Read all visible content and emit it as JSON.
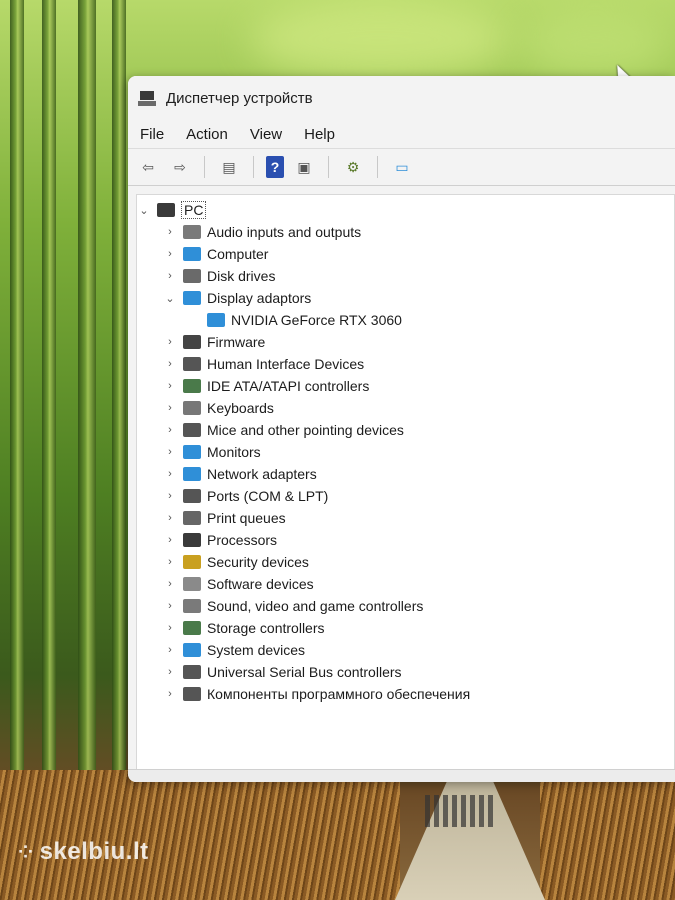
{
  "window": {
    "title": "Диспетчер устройств"
  },
  "menu": [
    "File",
    "Action",
    "View",
    "Help"
  ],
  "toolbar": [
    {
      "name": "back-icon",
      "glyph": "⇦"
    },
    {
      "name": "forward-icon",
      "glyph": "⇨"
    },
    {
      "name": "sep"
    },
    {
      "name": "properties-icon",
      "glyph": "▤"
    },
    {
      "name": "sep"
    },
    {
      "name": "help-icon",
      "glyph": "?"
    },
    {
      "name": "view-icon",
      "glyph": "▣"
    },
    {
      "name": "sep"
    },
    {
      "name": "scan-hardware-icon",
      "glyph": "⚙"
    },
    {
      "name": "sep"
    },
    {
      "name": "monitor-icon",
      "glyph": "▭"
    }
  ],
  "tree": {
    "root": "PC",
    "items": [
      {
        "label": "Audio inputs and outputs",
        "icon": "speaker-icon",
        "color": "#7a7a7a",
        "expanded": false
      },
      {
        "label": "Computer",
        "icon": "computer-icon",
        "color": "#2f8fd8",
        "expanded": false
      },
      {
        "label": "Disk drives",
        "icon": "disk-icon",
        "color": "#6a6a6a",
        "expanded": false
      },
      {
        "label": "Display adaptors",
        "icon": "display-adapter-icon",
        "color": "#2f8fd8",
        "expanded": true,
        "children": [
          {
            "label": "NVIDIA GeForce RTX 3060",
            "icon": "display-adapter-icon",
            "color": "#2f8fd8"
          }
        ]
      },
      {
        "label": "Firmware",
        "icon": "chip-icon",
        "color": "#444444",
        "expanded": false
      },
      {
        "label": "Human Interface Devices",
        "icon": "hid-icon",
        "color": "#555555",
        "expanded": false
      },
      {
        "label": "IDE ATA/ATAPI controllers",
        "icon": "ide-icon",
        "color": "#4a7a4a",
        "expanded": false
      },
      {
        "label": "Keyboards",
        "icon": "keyboard-icon",
        "color": "#777777",
        "expanded": false
      },
      {
        "label": "Mice and other pointing devices",
        "icon": "mouse-icon",
        "color": "#555555",
        "expanded": false
      },
      {
        "label": "Monitors",
        "icon": "monitor-icon",
        "color": "#2f8fd8",
        "expanded": false
      },
      {
        "label": "Network adapters",
        "icon": "network-icon",
        "color": "#2f8fd8",
        "expanded": false
      },
      {
        "label": "Ports (COM & LPT)",
        "icon": "port-icon",
        "color": "#555555",
        "expanded": false
      },
      {
        "label": "Print queues",
        "icon": "printer-icon",
        "color": "#666666",
        "expanded": false
      },
      {
        "label": "Processors",
        "icon": "cpu-icon",
        "color": "#3a3a3a",
        "expanded": false
      },
      {
        "label": "Security devices",
        "icon": "security-icon",
        "color": "#c9a020",
        "expanded": false
      },
      {
        "label": "Software devices",
        "icon": "software-icon",
        "color": "#8a8a8a",
        "expanded": false
      },
      {
        "label": "Sound, video and game controllers",
        "icon": "sound-icon",
        "color": "#7a7a7a",
        "expanded": false
      },
      {
        "label": "Storage controllers",
        "icon": "storage-icon",
        "color": "#4a7a4a",
        "expanded": false
      },
      {
        "label": "System devices",
        "icon": "system-icon",
        "color": "#2f8fd8",
        "expanded": false
      },
      {
        "label": "Universal Serial Bus controllers",
        "icon": "usb-icon",
        "color": "#555555",
        "expanded": false
      },
      {
        "label": "Компоненты программного обеспечения",
        "icon": "component-icon",
        "color": "#555555",
        "expanded": false
      }
    ]
  },
  "watermark": "skelbiu.lt"
}
